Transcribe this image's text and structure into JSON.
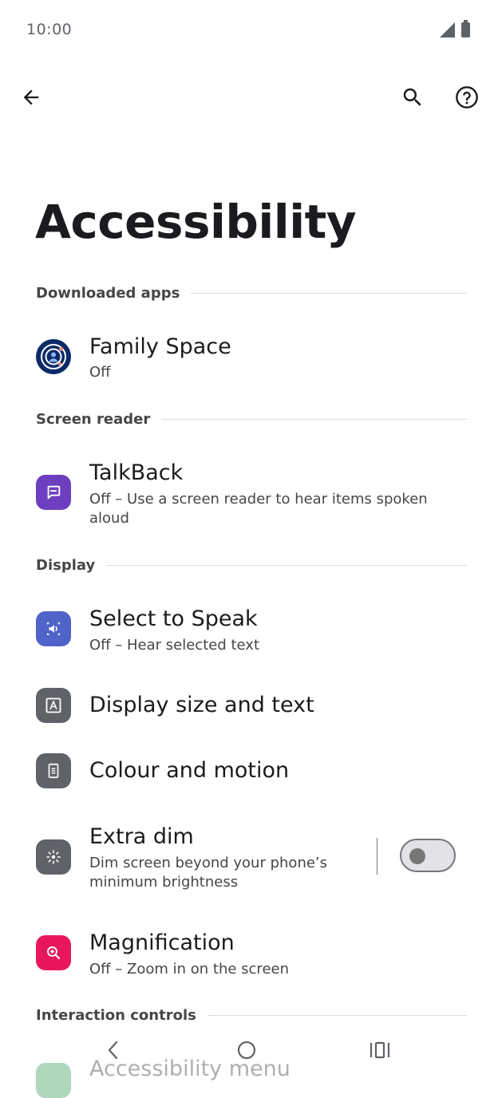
{
  "status_bar": {
    "time": "10:00",
    "icons": [
      "signal-icon",
      "battery-icon"
    ]
  },
  "app_bar": {
    "icons": [
      "back-arrow-icon",
      "search-icon",
      "help-icon"
    ]
  },
  "page": {
    "title": "Accessibility"
  },
  "sections": {
    "downloaded_apps": "Downloaded apps",
    "screen_reader": "Screen reader",
    "display": "Display",
    "interaction_controls": "Interaction controls"
  },
  "items": {
    "family_space": {
      "title": "Family Space",
      "subtitle": "Off",
      "icon": "family-space-icon"
    },
    "talkback": {
      "title": "TalkBack",
      "subtitle": "Off – Use a screen reader to hear items spoken aloud",
      "icon": "talkback-icon"
    },
    "select_to_speak": {
      "title": "Select to Speak",
      "subtitle": "Off – Hear selected text",
      "icon": "select-to-speak-icon"
    },
    "display_size": {
      "title": "Display size and text",
      "icon": "display-size-icon"
    },
    "colour_motion": {
      "title": "Colour and motion",
      "icon": "colour-motion-icon"
    },
    "extra_dim": {
      "title": "Extra dim",
      "subtitle": "Dim screen beyond your phone’s minimum brightness",
      "icon": "extra-dim-icon",
      "toggle_on": false
    },
    "magnification": {
      "title": "Magnification",
      "subtitle": "Off – Zoom in on the screen",
      "icon": "magnification-icon"
    },
    "accessibility_menu": {
      "title": "Accessibility menu",
      "icon": "accessibility-menu-icon"
    }
  },
  "colors": {
    "talkback": "#6d3fc0",
    "select_to_speak": "#4f63c8",
    "display_tiles": "#5f6368",
    "magnification": "#e8175d",
    "family_space_bg": "#0b2a66"
  },
  "nav_bar": {
    "icons": [
      "nav-back-icon",
      "nav-home-icon",
      "nav-recents-icon"
    ]
  }
}
